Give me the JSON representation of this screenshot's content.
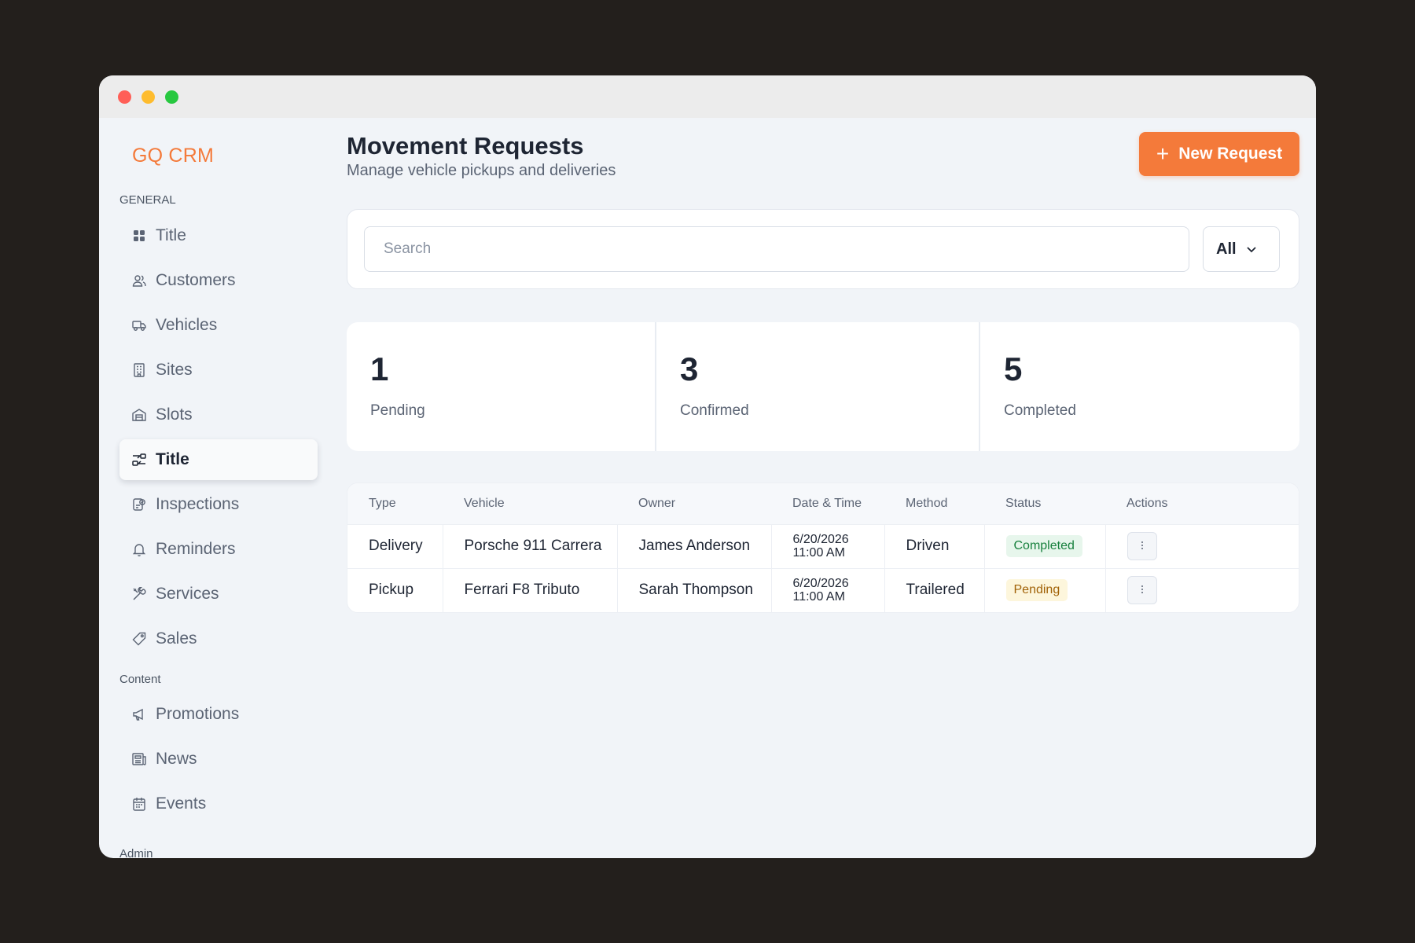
{
  "app": {
    "brand": "GQ CRM"
  },
  "sidebar": {
    "sections": {
      "general": "GENERAL",
      "content": "Content",
      "admin": "Admin"
    },
    "items": [
      {
        "label": "Title",
        "icon": "grid-icon"
      },
      {
        "label": "Customers",
        "icon": "users-icon"
      },
      {
        "label": "Vehicles",
        "icon": "truck-icon"
      },
      {
        "label": "Sites",
        "icon": "building-icon"
      },
      {
        "label": "Slots",
        "icon": "garage-icon"
      },
      {
        "label": "Title",
        "icon": "movement-icon",
        "active": true
      },
      {
        "label": "Inspections",
        "icon": "clipboard-check-icon"
      },
      {
        "label": "Reminders",
        "icon": "bell-icon"
      },
      {
        "label": "Services",
        "icon": "wrench-icon"
      },
      {
        "label": "Sales",
        "icon": "tag-icon"
      },
      {
        "label": "Promotions",
        "icon": "megaphone-icon"
      },
      {
        "label": "News",
        "icon": "newspaper-icon"
      },
      {
        "label": "Events",
        "icon": "calendar-icon"
      }
    ]
  },
  "header": {
    "title": "Movement Requests",
    "subtitle": "Manage vehicle pickups and deliveries",
    "new_button_label": "New Request"
  },
  "search": {
    "placeholder": "Search",
    "filter_value": "All"
  },
  "stats": [
    {
      "value": "1",
      "label": "Pending"
    },
    {
      "value": "3",
      "label": "Confirmed"
    },
    {
      "value": "5",
      "label": "Completed"
    }
  ],
  "table": {
    "columns": [
      "Type",
      "Vehicle",
      "Owner",
      "Date & Time",
      "Method",
      "Status",
      "Actions"
    ],
    "rows": [
      {
        "type": "Delivery",
        "vehicle": "Porsche 911 Carrera",
        "owner": "James Anderson",
        "date": "6/20/2026",
        "time": "11:00 AM",
        "method": "Driven",
        "status": "Completed"
      },
      {
        "type": "Pickup",
        "vehicle": "Ferrari F8 Tributo",
        "owner": "Sarah Thompson",
        "date": "6/20/2026",
        "time": "11:00 AM",
        "method": "Trailered",
        "status": "Pending"
      }
    ]
  },
  "colors": {
    "accent": "#f47a3a",
    "completed": "#17803d",
    "pending": "#a16207"
  }
}
